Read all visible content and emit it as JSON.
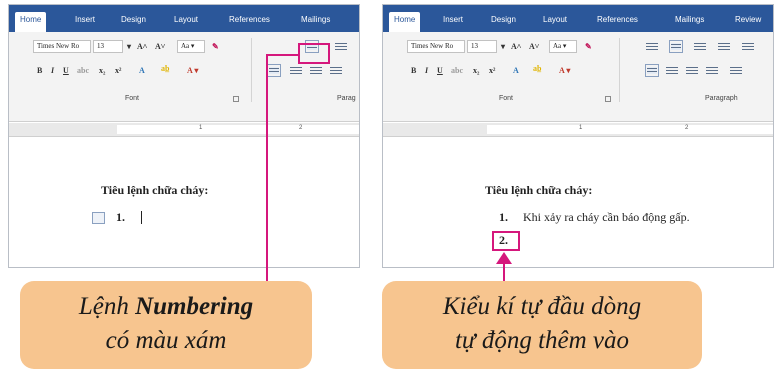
{
  "left": {
    "tabs": [
      "Home",
      "Insert",
      "Design",
      "Layout",
      "References",
      "Mailings"
    ],
    "font_name": "Times New Ro",
    "font_size": "13",
    "font_group_label": "Font",
    "paragraph_group_label": "Parag",
    "ruler_numbers": [
      "1",
      "2"
    ],
    "doc_title": "Tiêu lệnh chữa cháy:",
    "list_marker": "1."
  },
  "right": {
    "tabs": [
      "Home",
      "Insert",
      "Design",
      "Layout",
      "References",
      "Mailings",
      "Review"
    ],
    "font_name": "Times New Ro",
    "font_size": "13",
    "font_group_label": "Font",
    "paragraph_group_label": "Paragraph",
    "ruler_numbers": [
      "1",
      "2"
    ],
    "doc_title": "Tiêu lệnh chữa cháy:",
    "item1_marker": "1.",
    "item1_text": "Khi xảy ra cháy cần báo động gấp.",
    "item2_marker": "2."
  },
  "callout_left": {
    "line1_prefix": "Lệnh ",
    "line1_bold": "Numbering",
    "line2": "có màu xám"
  },
  "callout_right": {
    "line1": "Kiểu kí tự đầu dòng",
    "line2": "tự động thêm vào"
  },
  "colors": {
    "tab_bar": "#2b579a",
    "highlight": "#d5177c",
    "callout_fill": "#f7c58f"
  },
  "icons": [
    "numbering-icon",
    "bullets-icon",
    "multilevel-list-icon",
    "align-left-icon",
    "center-icon",
    "align-right-icon",
    "justify-icon",
    "autocorrect-icon",
    "dialog-launcher-icon"
  ]
}
